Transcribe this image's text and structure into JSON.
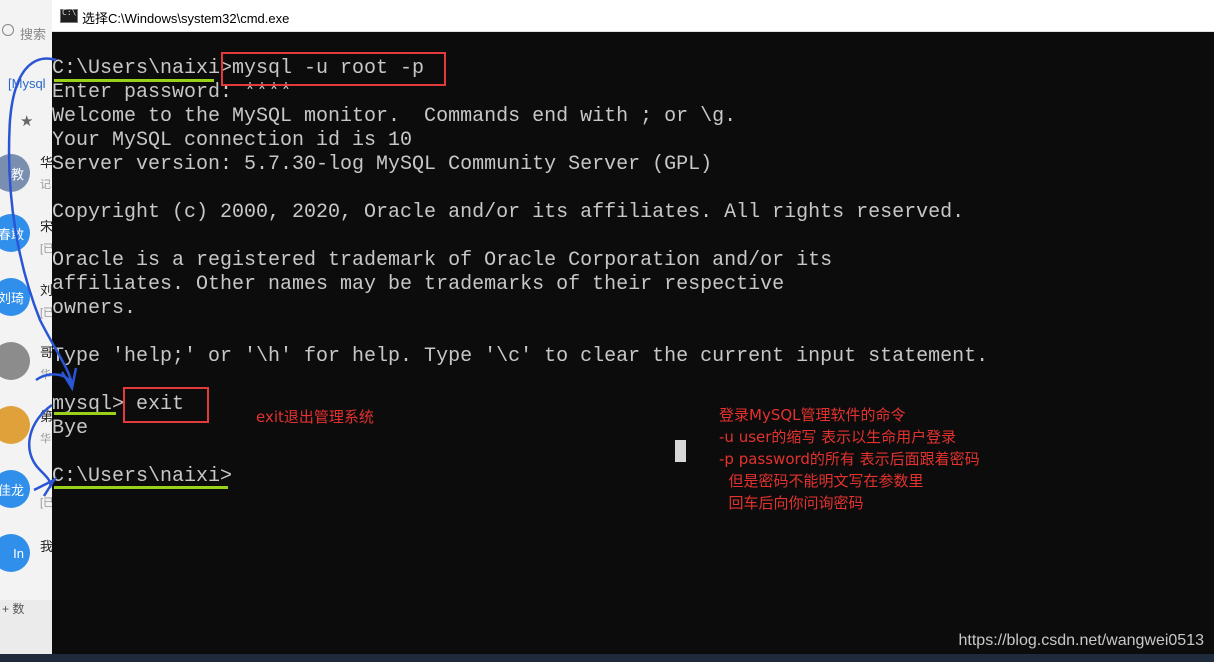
{
  "background_app": {
    "search_label": "搜索",
    "link_text": "[Mysql",
    "avatars": [
      {
        "label": "教",
        "name": "华",
        "sub": "记"
      },
      {
        "label": "春敢",
        "name": "宋",
        "sub": "[已"
      },
      {
        "label": "刘琦",
        "name": "刘",
        "sub": "[已"
      },
      {
        "label": "",
        "name": "哥",
        "sub": "华"
      },
      {
        "label": "",
        "name": "第",
        "sub": "华"
      },
      {
        "label": "佳龙",
        "name": "",
        "sub": "[已"
      },
      {
        "label": "In",
        "name": "我",
        "sub": ""
      }
    ],
    "bottom_text": "+ 数"
  },
  "window": {
    "title": "选择C:\\Windows\\system32\\cmd.exe"
  },
  "console": {
    "prompt1": "C:\\Users\\naixi>",
    "cmd1": "mysql -u root -p",
    "line_enter_password": "Enter password: ****",
    "line_welcome": "Welcome to the MySQL monitor.  Commands end with ; or \\g.",
    "line_connection": "Your MySQL connection id is 10",
    "line_server": "Server version: 5.7.30-log MySQL Community Server (GPL)",
    "line_copyright": "Copyright (c) 2000, 2020, Oracle and/or its affiliates. All rights reserved.",
    "line_oracle1": "Oracle is a registered trademark of Oracle Corporation and/or its",
    "line_oracle2": "affiliates. Other names may be trademarks of their respective",
    "line_oracle3": "owners.",
    "line_help": "Type 'help;' or '\\h' for help. Type '\\c' to clear the current input statement.",
    "prompt2": "mysql>",
    "cmd2": " exit",
    "line_bye": "Bye",
    "prompt3": "C:\\Users\\naixi>"
  },
  "annotations": {
    "exit_note": "exit退出管理系统",
    "login_notes": [
      "登录MySQL管理软件的命令",
      "-u user的缩写 表示以生命用户登录",
      "-p password的所有 表示后面跟着密码",
      "  但是密码不能明文写在参数里",
      "  回车后向你问询密码"
    ]
  },
  "watermark": "https://blog.csdn.net/wangwei0513",
  "colors": {
    "console_bg": "#0c0c0c",
    "console_text": "#c7c7c7",
    "annotation_red": "#e33b3b",
    "underline_green": "#9ad11a",
    "arrow_blue": "#2a55d4"
  }
}
